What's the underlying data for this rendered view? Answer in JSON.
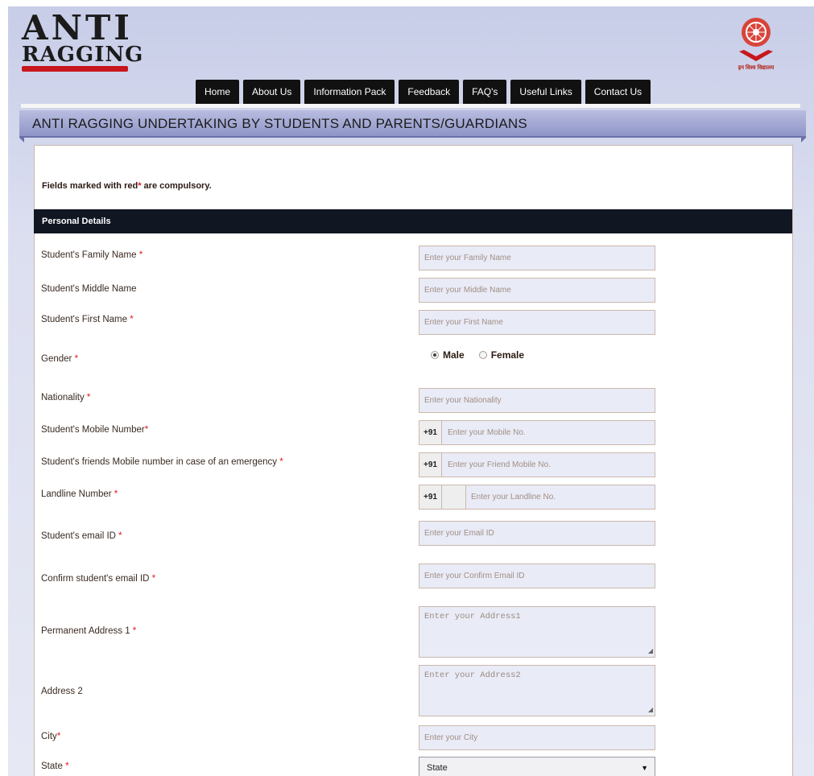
{
  "header": {
    "logo_line1": "ANTI",
    "logo_line2": "RAGGING",
    "emblem_caption": "इन विश्व विद्यालय"
  },
  "nav": [
    "Home",
    "About Us",
    "Information Pack",
    "Feedback",
    "FAQ's",
    "Useful Links",
    "Contact Us"
  ],
  "page_title": "ANTI RAGGING UNDERTAKING BY STUDENTS AND PARENTS/GUARDIANS",
  "note": {
    "prefix": "Fields marked with red",
    "star": "*",
    "suffix": " are compulsory."
  },
  "section": "Personal Details",
  "required_mark": "*",
  "fields": {
    "family_name": {
      "label": "Student's Family Name",
      "placeholder": "Enter your Family Name"
    },
    "middle_name": {
      "label": "Student's Middle Name",
      "placeholder": "Enter your Middle Name"
    },
    "first_name": {
      "label": "Student's First Name",
      "placeholder": "Enter your First Name"
    },
    "gender": {
      "label": "Gender",
      "options": [
        "Male",
        "Female"
      ],
      "selected": "Male"
    },
    "nationality": {
      "label": "Nationality",
      "placeholder": "Enter your Nationality"
    },
    "mobile": {
      "label": "Student's Mobile Number",
      "prefix": "+91",
      "placeholder": "Enter your Mobile No."
    },
    "friend_mobile": {
      "label": "Student's friends Mobile number in case of an emergency",
      "prefix": "+91",
      "placeholder": "Enter your Friend Mobile No."
    },
    "landline": {
      "label": "Landline Number",
      "prefix": "+91",
      "placeholder": "Enter your Landline No."
    },
    "email": {
      "label": "Student's email ID",
      "placeholder": "Enter your Email ID"
    },
    "confirm_email": {
      "label": "Confirm student's email ID",
      "placeholder": "Enter your Confirm Email ID"
    },
    "address1": {
      "label": "Permanent Address 1",
      "placeholder": "Enter your Address1"
    },
    "address2": {
      "label": "Address 2",
      "placeholder": "Enter your Address2"
    },
    "city": {
      "label": "City",
      "placeholder": "Enter your City"
    },
    "state": {
      "label": "State",
      "selected": "State"
    }
  }
}
